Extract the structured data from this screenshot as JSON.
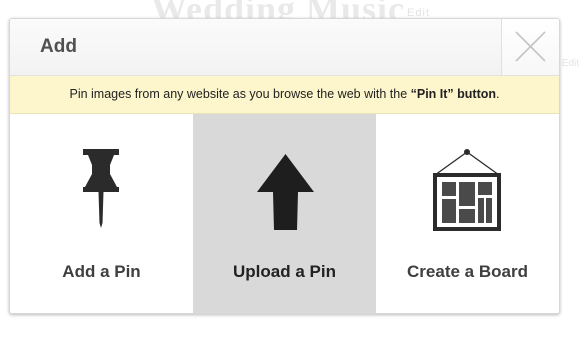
{
  "background": {
    "page_title": "Wedding Music",
    "title_tag": "Edit",
    "side_text": "Edit"
  },
  "modal": {
    "title": "Add",
    "close_icon": "close-icon"
  },
  "notice": {
    "prefix": "Pin images from any website as you browse the web with the ",
    "highlight": "“Pin It” button",
    "suffix": "."
  },
  "options": [
    {
      "label": "Add a Pin",
      "icon": "pushpin-icon",
      "selected": false
    },
    {
      "label": "Upload a Pin",
      "icon": "upload-arrow-icon",
      "selected": true
    },
    {
      "label": "Create a Board",
      "icon": "board-frame-icon",
      "selected": false
    }
  ],
  "colors": {
    "selected_background": "#d9d9d9",
    "notice_background": "#fdf6cc",
    "icon_color": "#2b2b2b"
  }
}
